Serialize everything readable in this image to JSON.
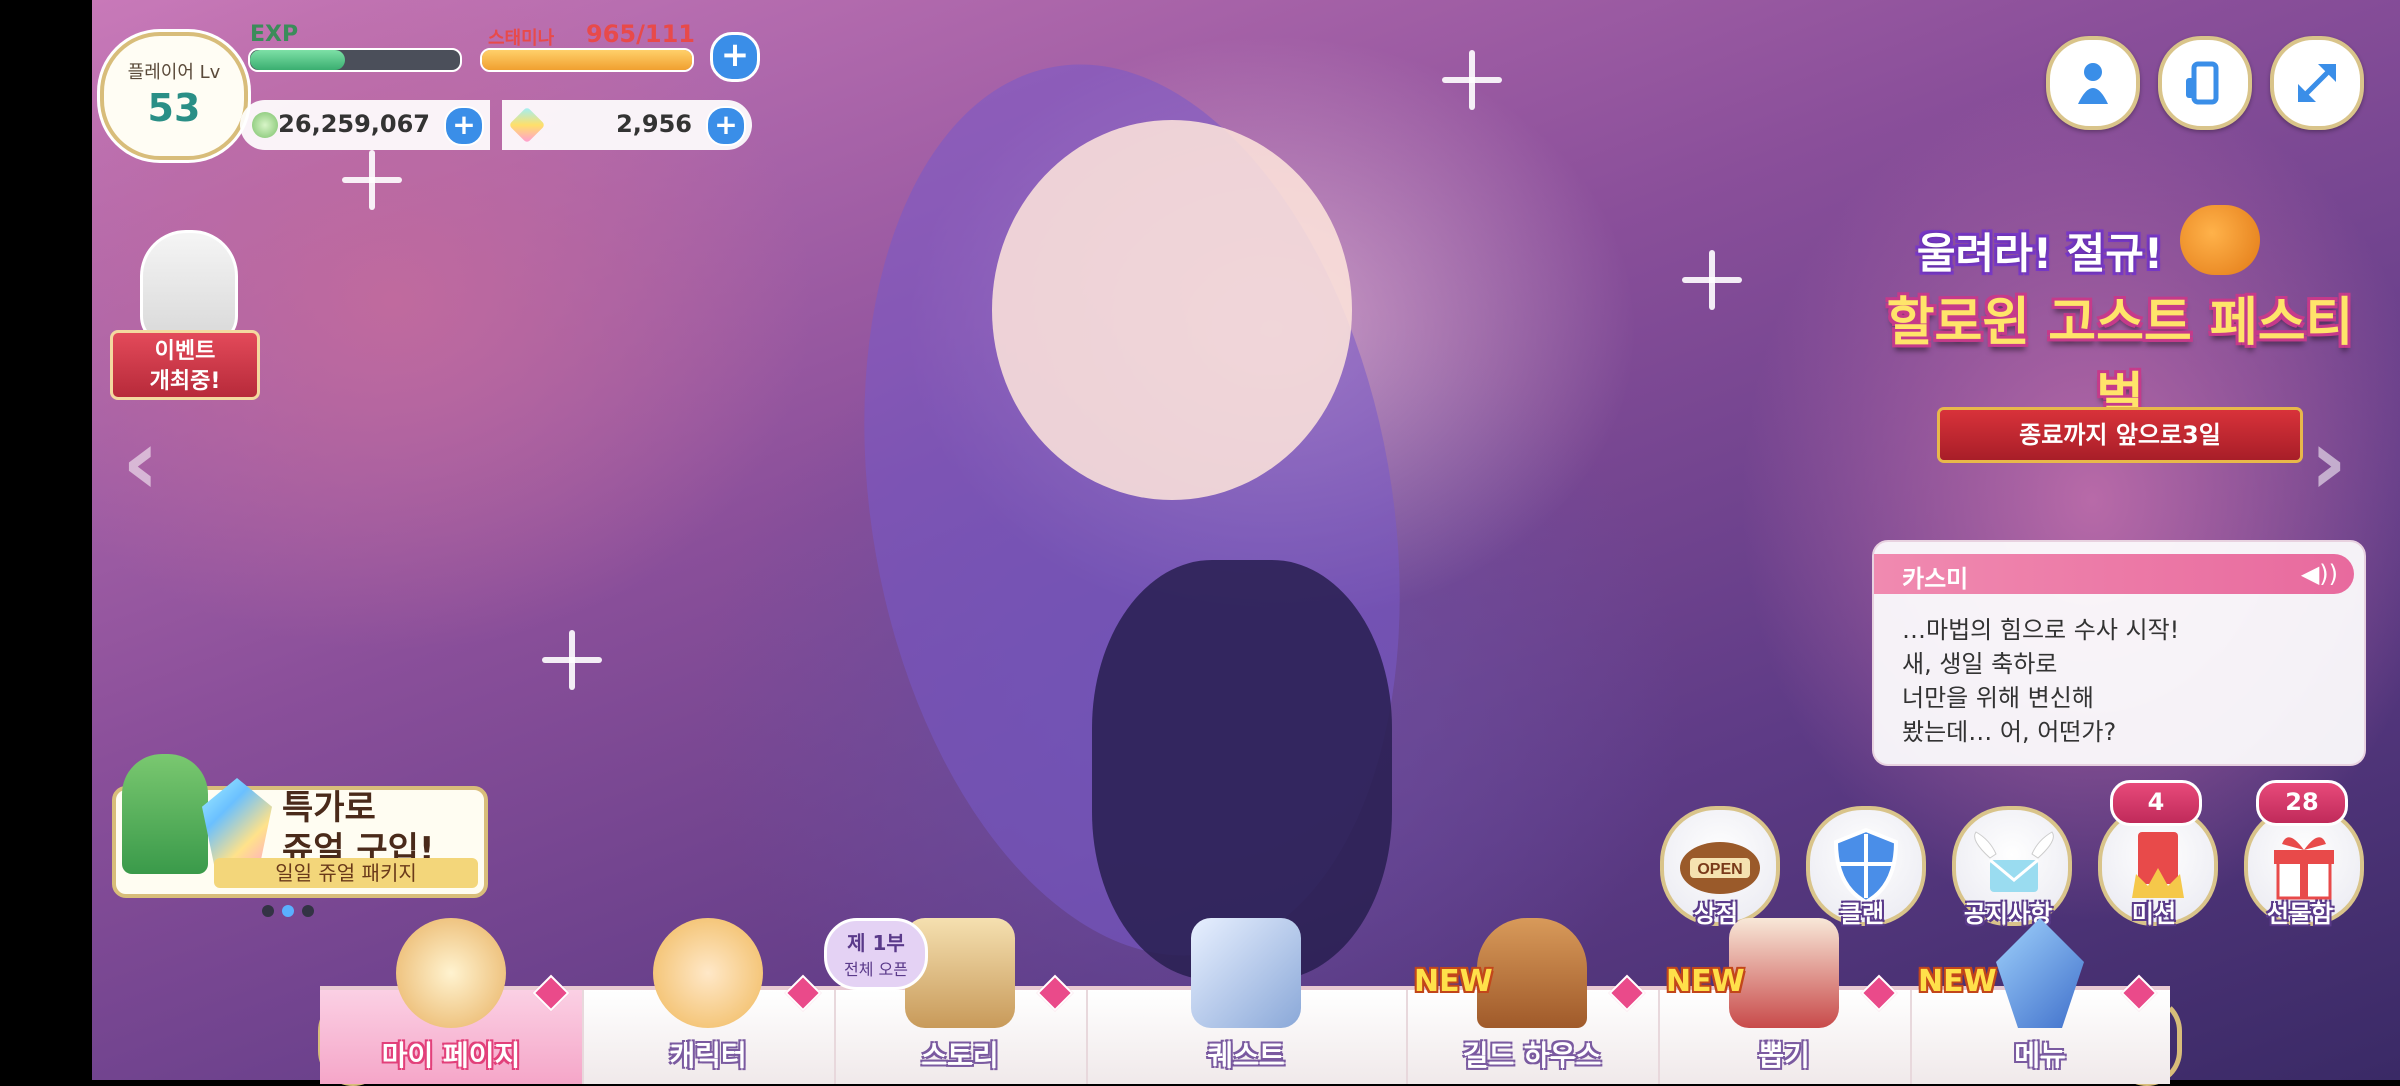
{
  "player": {
    "level_label": "플레이어 Lv",
    "level": "53",
    "exp_label": "EXP",
    "exp_fraction": 0.45,
    "stamina_label": "스태미나",
    "stamina_value": "965/111",
    "stamina_fraction": 1.0,
    "mana": "26,259,067",
    "jewels": "2,956"
  },
  "top_right": {
    "buttons": [
      {
        "icon": "character-silhouette-icon"
      },
      {
        "icon": "device-rotate-icon"
      },
      {
        "icon": "expand-arrows-icon"
      }
    ]
  },
  "event_left": {
    "line1": "이벤트",
    "line2": "개최중!"
  },
  "banner": {
    "title1": "울려라! 절규!",
    "title2": "할로윈 고스트 페스티벌",
    "subtitle": "종료까지 앞으로3일"
  },
  "speech": {
    "name": "카스미",
    "lines": [
      "…마법의 힘으로 수사 시작!",
      "새, 생일 축하로",
      "너만을 위해 변신해",
      "봤는데… 어, 어떤가?"
    ]
  },
  "promo": {
    "title1": "특가로",
    "title2": "쥬얼 구입!",
    "subtitle": "일일 쥬얼 패키지"
  },
  "actions": [
    {
      "label": "상점",
      "icon": "shop-open-sign-icon",
      "badge": ""
    },
    {
      "label": "클랜",
      "icon": "shield-icon",
      "badge": ""
    },
    {
      "label": "공지사항",
      "icon": "winged-envelope-icon",
      "badge": ""
    },
    {
      "label": "미션",
      "icon": "mission-crown-icon",
      "badge": "4"
    },
    {
      "label": "선물함",
      "icon": "gift-box-icon",
      "badge": "28"
    }
  ],
  "nav": {
    "items": [
      {
        "label": "마이 페이지",
        "icon": "house-icon",
        "active": true
      },
      {
        "label": "캐릭터",
        "icon": "character-icon",
        "active": false
      },
      {
        "label": "스토리",
        "icon": "scroll-icon",
        "active": false,
        "bubble1": "제 1부",
        "bubble2": "전체 오픈"
      },
      {
        "label": "퀘스트",
        "icon": "sword-flag-icon",
        "active": false
      },
      {
        "label": "길드 하우스",
        "icon": "door-icon",
        "active": false,
        "new": "NEW"
      },
      {
        "label": "뽑기",
        "icon": "gacha-machine-icon",
        "active": false,
        "new": "NEW"
      },
      {
        "label": "메뉴",
        "icon": "crystal-icon",
        "active": false,
        "new": "NEW"
      }
    ]
  },
  "colors": {
    "accent_pink": "#e86a9e",
    "gold_border": "#d8bd7a",
    "button_blue": "#3a8ee8"
  }
}
